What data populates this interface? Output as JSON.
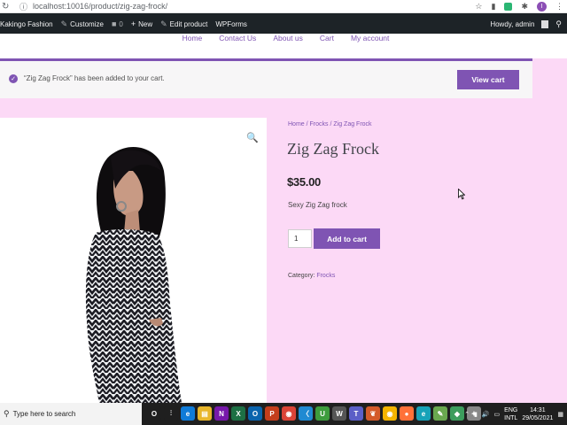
{
  "browser": {
    "url": "localhost:10016/product/zig-zag-frock/",
    "profile_initial": "I"
  },
  "adminbar": {
    "site_name": "Kakingo Fashion",
    "customize": "Customize",
    "comments_count": "0",
    "new": "New",
    "edit_product": "Edit product",
    "wpforms": "WPForms",
    "howdy": "Howdy, admin"
  },
  "nav": {
    "items": [
      "Home",
      "Contact Us",
      "About us",
      "Cart",
      "My account"
    ]
  },
  "notice": {
    "message": "“Zig Zag Frock” has been added to your cart.",
    "button": "View cart"
  },
  "product": {
    "breadcrumb": [
      "Home",
      "Frocks",
      "Zig Zag Frock"
    ],
    "title": "Zig Zag Frock",
    "price": "$35.00",
    "description": "Sexy Zig Zag frock",
    "quantity": "1",
    "add_to_cart": "Add to cart",
    "category_label": "Category:",
    "category": "Frocks"
  },
  "taskbar": {
    "search_placeholder": "Type here to search",
    "lang_top": "ENG",
    "lang_bottom": "INTL",
    "time": "14:31",
    "date": "29/05/2021",
    "apps": [
      {
        "name": "cortana-icon",
        "glyph": "O",
        "color": "#1f1f1f"
      },
      {
        "name": "task-view-icon",
        "glyph": "⫶",
        "color": "#1f1f1f"
      },
      {
        "name": "edge-icon",
        "glyph": "e",
        "color": "#0f7bd8"
      },
      {
        "name": "file-explorer-icon",
        "glyph": "▤",
        "color": "#e8b62b"
      },
      {
        "name": "onenote-icon",
        "glyph": "N",
        "color": "#7719aa"
      },
      {
        "name": "excel-icon",
        "glyph": "X",
        "color": "#1d7044"
      },
      {
        "name": "outlook-icon",
        "glyph": "O",
        "color": "#0a64ad"
      },
      {
        "name": "powerpoint-icon",
        "glyph": "P",
        "color": "#c43e1c"
      },
      {
        "name": "chrome-icon",
        "glyph": "◉",
        "color": "#db4437"
      },
      {
        "name": "vscode-icon",
        "glyph": "〈",
        "color": "#1f8ad2"
      },
      {
        "name": "app-green-icon",
        "glyph": "U",
        "color": "#3d9c3d"
      },
      {
        "name": "wordpress-icon",
        "glyph": "W",
        "color": "#555555"
      },
      {
        "name": "teams-icon",
        "glyph": "T",
        "color": "#5b5fc7"
      },
      {
        "name": "local-wp-icon",
        "glyph": "❦",
        "color": "#d45b2a"
      },
      {
        "name": "chrome-active-icon",
        "glyph": "◉",
        "color": "#f4b400"
      },
      {
        "name": "firefox-icon",
        "glyph": "●",
        "color": "#ff7139"
      },
      {
        "name": "edge-canary-icon",
        "glyph": "e",
        "color": "#17a2b8"
      },
      {
        "name": "paint-icon",
        "glyph": "✎",
        "color": "#6aa84f"
      },
      {
        "name": "app-diamond-icon",
        "glyph": "◆",
        "color": "#3c9d5d"
      },
      {
        "name": "app-grid-icon",
        "glyph": "✦",
        "color": "#888888"
      }
    ]
  },
  "colors": {
    "accent": "#7f54b3",
    "page_bg": "#fcd9f6"
  }
}
